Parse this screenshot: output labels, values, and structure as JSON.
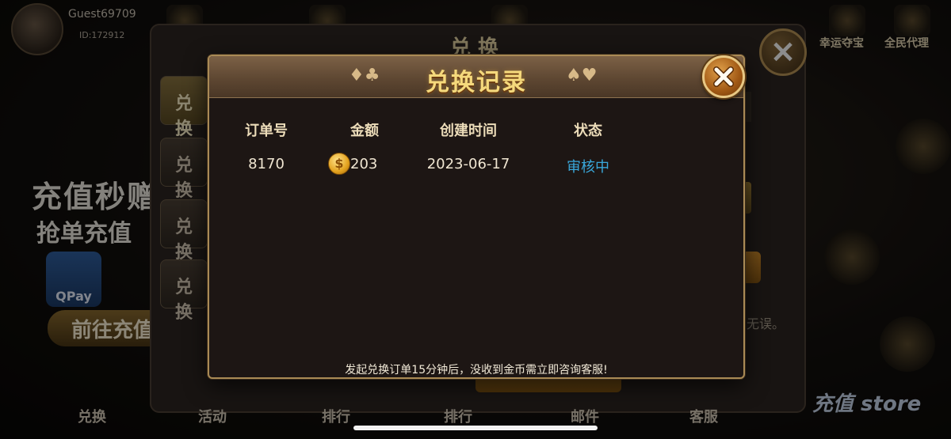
{
  "background": {
    "guest_name": "Guest69709",
    "guest_id": "ID:172912",
    "top_labels": [
      "幸运夺宝",
      "全民代理"
    ],
    "panel_title": "兑 换",
    "side_tabs": [
      "兑换",
      "兑换",
      "兑换",
      "兑换"
    ],
    "promo_line1": "充值秒赠",
    "promo_line2": "抢单充值",
    "qpay_label": "QPay",
    "goto_button": "前往充值",
    "right_hint": "无误。",
    "bottom_nav": [
      "兑换",
      "活动",
      "排行",
      "排行",
      "邮件",
      "客服"
    ],
    "store_label": "充值 store"
  },
  "modal": {
    "title": "兑换记录",
    "left_suits": "♦♣",
    "right_suits": "♠♥",
    "close_icon": "close-icon",
    "columns": [
      "订单号",
      "金额",
      "创建时间",
      "状态"
    ],
    "rows": [
      {
        "order_no": "8170",
        "amount": "203",
        "created": "2023-06-17",
        "status": "审核中"
      }
    ],
    "coin_symbol": "$",
    "notice": "发起兑换订单15分钟后，没收到金币需立即咨询客服!"
  },
  "colors": {
    "title_gold": "#f5d97c",
    "status_blue": "#39a7da",
    "border_gold": "#a98a55"
  }
}
